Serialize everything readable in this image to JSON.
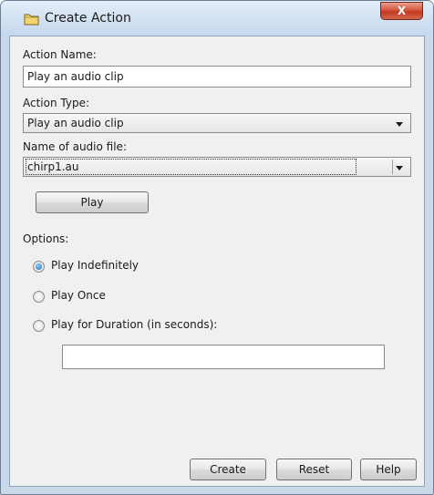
{
  "window": {
    "title": "Create Action",
    "close_label": "X"
  },
  "form": {
    "action_name_label": "Action Name:",
    "action_name_value": "Play an audio clip",
    "action_type_label": "Action Type:",
    "action_type_selected": "Play an audio clip",
    "audio_file_label": "Name of audio file:",
    "audio_file_selected": "chirp1.au",
    "play_label": "Play",
    "options_label": "Options:",
    "options": [
      {
        "label": "Play Indefinitely",
        "checked": true
      },
      {
        "label": "Play Once",
        "checked": false
      },
      {
        "label": "Play for Duration (in seconds):",
        "checked": false
      }
    ],
    "duration_value": ""
  },
  "footer": {
    "create_label": "Create",
    "reset_label": "Reset",
    "help_label": "Help"
  },
  "icons": {
    "title": "folder-icon",
    "combo_arrow": "chevron-down-icon"
  }
}
